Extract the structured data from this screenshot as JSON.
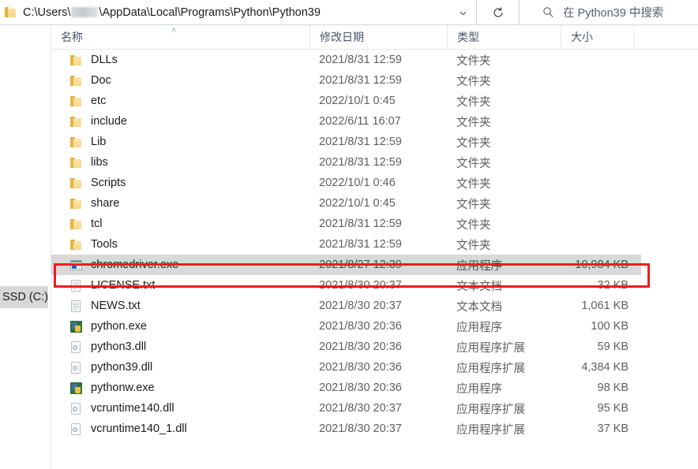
{
  "window": {
    "type": "windows-file-explorer"
  },
  "toolbar": {
    "address": {
      "prefix": "C:\\Users\\",
      "redacted_username": "",
      "suffix": "\\AppData\\Local\\Programs\\Python\\Python39",
      "folder_icon": "folder-icon",
      "dropdown_icon": "chevron-down-icon"
    },
    "refresh": {
      "icon": "refresh-icon",
      "label": ""
    },
    "search": {
      "icon": "search-icon",
      "placeholder": "在 Python39 中搜索",
      "value": ""
    }
  },
  "sidebar": {
    "items": [
      {
        "label": "SSD (C:)",
        "selected": true
      }
    ]
  },
  "columns": {
    "name": "名称",
    "date": "修改日期",
    "type": "类型",
    "size": "大小",
    "sort_indicator": "˄",
    "sort_column": "name",
    "sort_direction": "ascending"
  },
  "annotation": {
    "color": "#ee1c20",
    "target_row": "chromedriver.exe"
  },
  "files": [
    {
      "name": "DLLs",
      "date": "2021/8/31 12:59",
      "type": "文件夹",
      "size": "",
      "icon": "folder-icon",
      "selected": false
    },
    {
      "name": "Doc",
      "date": "2021/8/31 12:59",
      "type": "文件夹",
      "size": "",
      "icon": "folder-icon",
      "selected": false
    },
    {
      "name": "etc",
      "date": "2022/10/1 0:45",
      "type": "文件夹",
      "size": "",
      "icon": "folder-icon",
      "selected": false
    },
    {
      "name": "include",
      "date": "2022/6/11 16:07",
      "type": "文件夹",
      "size": "",
      "icon": "folder-icon",
      "selected": false
    },
    {
      "name": "Lib",
      "date": "2021/8/31 12:59",
      "type": "文件夹",
      "size": "",
      "icon": "folder-icon",
      "selected": false
    },
    {
      "name": "libs",
      "date": "2021/8/31 12:59",
      "type": "文件夹",
      "size": "",
      "icon": "folder-icon",
      "selected": false
    },
    {
      "name": "Scripts",
      "date": "2022/10/1 0:46",
      "type": "文件夹",
      "size": "",
      "icon": "folder-icon",
      "selected": false
    },
    {
      "name": "share",
      "date": "2022/10/1 0:45",
      "type": "文件夹",
      "size": "",
      "icon": "folder-icon",
      "selected": false
    },
    {
      "name": "tcl",
      "date": "2021/8/31 12:59",
      "type": "文件夹",
      "size": "",
      "icon": "folder-icon",
      "selected": false
    },
    {
      "name": "Tools",
      "date": "2021/8/31 12:59",
      "type": "文件夹",
      "size": "",
      "icon": "folder-icon",
      "selected": false
    },
    {
      "name": "chromedriver.exe",
      "date": "2021/8/27 12:39",
      "type": "应用程序",
      "size": "10,984 KB",
      "icon": "application-icon",
      "selected": true
    },
    {
      "name": "LICENSE.txt",
      "date": "2021/8/30 20:37",
      "type": "文本文档",
      "size": "32 KB",
      "icon": "text-document-icon",
      "selected": false
    },
    {
      "name": "NEWS.txt",
      "date": "2021/8/30 20:37",
      "type": "文本文档",
      "size": "1,061 KB",
      "icon": "text-document-icon",
      "selected": false
    },
    {
      "name": "python.exe",
      "date": "2021/8/30 20:36",
      "type": "应用程序",
      "size": "100 KB",
      "icon": "python-icon",
      "selected": false
    },
    {
      "name": "python3.dll",
      "date": "2021/8/30 20:36",
      "type": "应用程序扩展",
      "size": "59 KB",
      "icon": "dll-icon",
      "selected": false
    },
    {
      "name": "python39.dll",
      "date": "2021/8/30 20:36",
      "type": "应用程序扩展",
      "size": "4,384 KB",
      "icon": "dll-icon",
      "selected": false
    },
    {
      "name": "pythonw.exe",
      "date": "2021/8/30 20:36",
      "type": "应用程序",
      "size": "98 KB",
      "icon": "python-icon",
      "selected": false
    },
    {
      "name": "vcruntime140.dll",
      "date": "2021/8/30 20:37",
      "type": "应用程序扩展",
      "size": "95 KB",
      "icon": "dll-icon",
      "selected": false
    },
    {
      "name": "vcruntime140_1.dll",
      "date": "2021/8/30 20:37",
      "type": "应用程序扩展",
      "size": "37 KB",
      "icon": "dll-icon",
      "selected": false
    }
  ]
}
